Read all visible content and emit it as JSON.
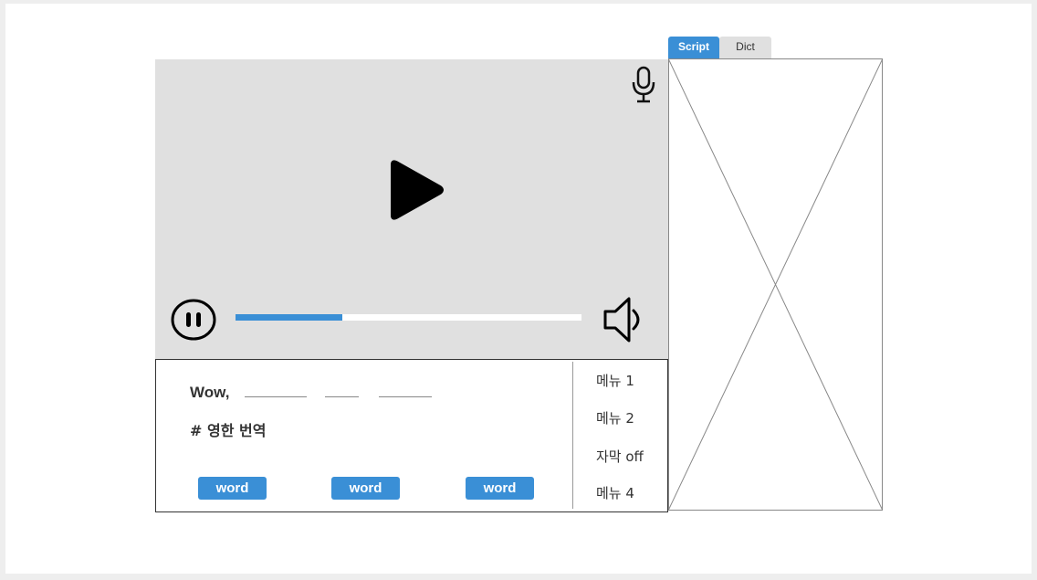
{
  "tabs": [
    {
      "label": "Script",
      "active": true
    },
    {
      "label": "Dict",
      "active": false
    }
  ],
  "player": {
    "progress": 0.31,
    "icons": [
      "microphone-icon",
      "play-icon",
      "pause-icon",
      "volume-icon"
    ]
  },
  "subtitle": {
    "text": "Wow,",
    "translation": "# 영한 번역"
  },
  "words": [
    "word",
    "word",
    "word"
  ],
  "menu": [
    "메뉴 1",
    "메뉴 2",
    "자막 off",
    "메뉴 4"
  ],
  "colors": {
    "accent": "#3a8fd6",
    "video_bg": "#e0e0e0",
    "tab_inactive": "#e0e0e0"
  }
}
